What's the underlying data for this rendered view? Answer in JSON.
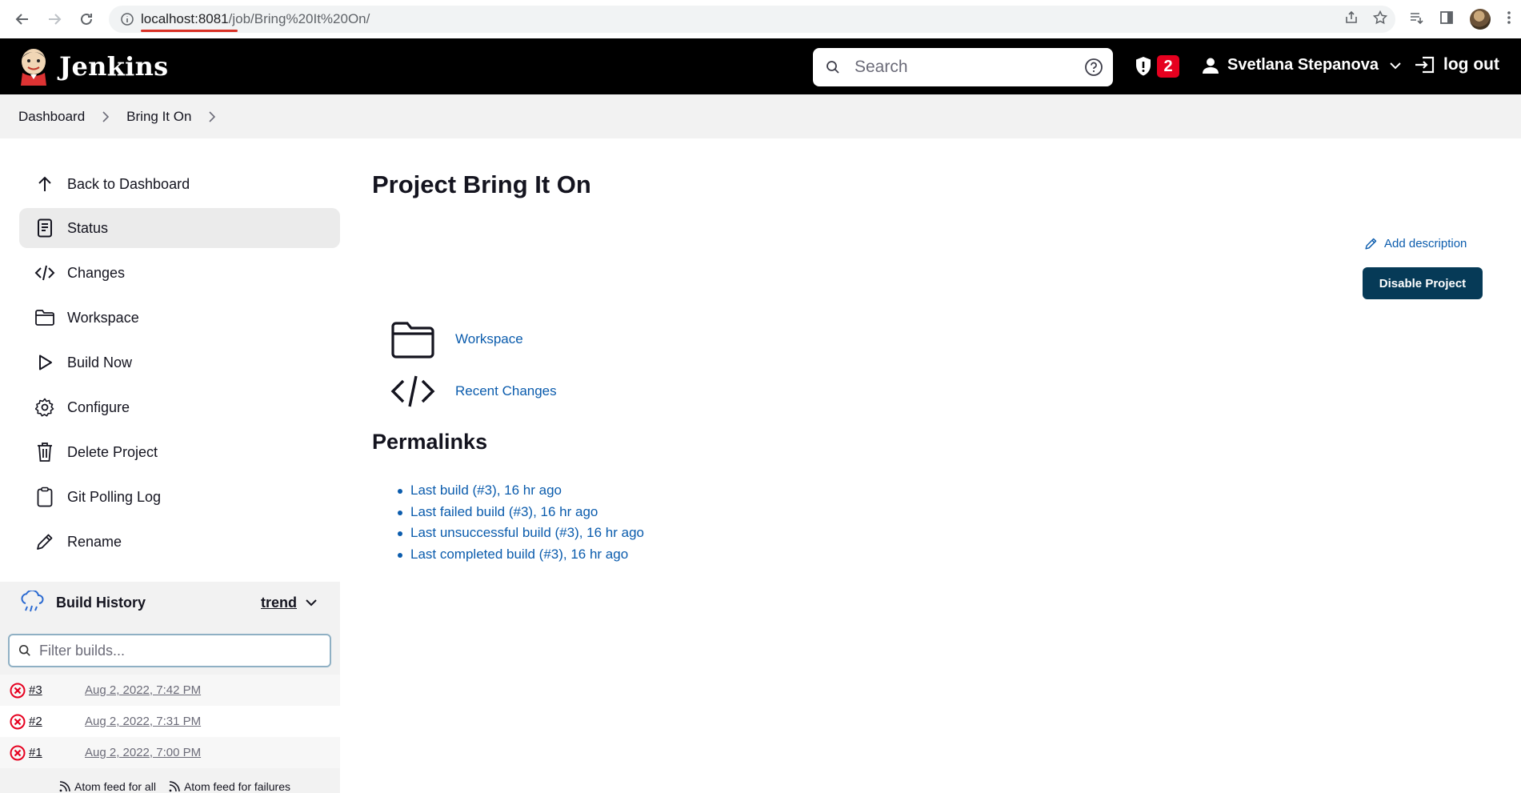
{
  "browser": {
    "url_host": "localhost:8081",
    "url_path": "/job/Bring%20It%20On/"
  },
  "header": {
    "brand": "Jenkins",
    "search_placeholder": "Search",
    "security_badge": "2",
    "user_name": "Svetlana Stepanova",
    "logout_label": "log out"
  },
  "breadcrumb": [
    "Dashboard",
    "Bring It On"
  ],
  "side_tasks": [
    {
      "label": "Back to Dashboard",
      "icon": "arrow-up-icon"
    },
    {
      "label": "Status",
      "icon": "document-icon"
    },
    {
      "label": "Changes",
      "icon": "code-icon"
    },
    {
      "label": "Workspace",
      "icon": "folder-icon"
    },
    {
      "label": "Build Now",
      "icon": "play-icon"
    },
    {
      "label": "Configure",
      "icon": "gear-icon"
    },
    {
      "label": "Delete Project",
      "icon": "trash-icon"
    },
    {
      "label": "Git Polling Log",
      "icon": "clipboard-icon"
    },
    {
      "label": "Rename",
      "icon": "pencil-icon"
    }
  ],
  "build_history": {
    "title": "Build History",
    "trend_label": "trend",
    "filter_placeholder": "Filter builds...",
    "builds": [
      {
        "number": "#3",
        "date": "Aug 2, 2022, 7:42 PM",
        "status": "failed"
      },
      {
        "number": "#2",
        "date": "Aug 2, 2022, 7:31 PM",
        "status": "failed"
      },
      {
        "number": "#1",
        "date": "Aug 2, 2022, 7:00 PM",
        "status": "failed"
      }
    ],
    "feed_all": "Atom feed for all",
    "feed_failures": "Atom feed for failures"
  },
  "main": {
    "title": "Project Bring It On",
    "add_description": "Add description",
    "disable_button": "Disable Project",
    "links": [
      {
        "label": "Workspace",
        "icon": "folder-icon"
      },
      {
        "label": "Recent Changes",
        "icon": "code-icon"
      }
    ],
    "permalinks_title": "Permalinks",
    "permalinks": [
      "Last build (#3), 16 hr ago",
      "Last failed build (#3), 16 hr ago",
      "Last unsuccessful build (#3), 16 hr ago",
      "Last completed build (#3), 16 hr ago"
    ]
  },
  "colors": {
    "header_bg": "#000000",
    "link": "#0b5cad",
    "primary_button": "#063a57",
    "badge": "#e6001f",
    "failed": "#e6001f"
  }
}
